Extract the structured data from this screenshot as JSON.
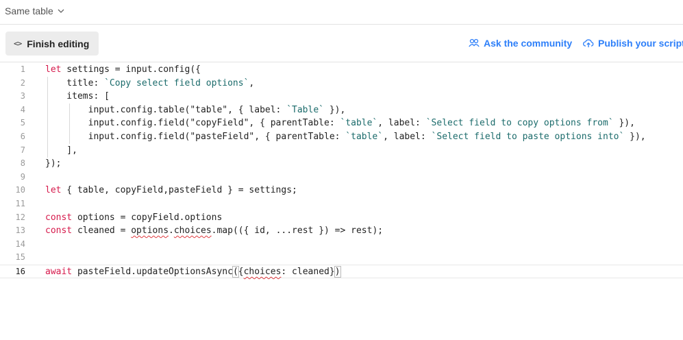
{
  "table_select": {
    "label": "Same table"
  },
  "toolbar": {
    "finish_label": "Finish editing",
    "ask_label": "Ask the community",
    "publish_label": "Publish your script"
  },
  "colors": {
    "accent": "#2d7ff9",
    "keyword": "#d6194b",
    "string": "#1b6b6b"
  },
  "code": {
    "active_line": 16,
    "lines": [
      {
        "n": "1",
        "parts": [
          [
            "kw",
            "let"
          ],
          [
            "",
            "",
            " settings = input.config({"
          ]
        ]
      },
      {
        "n": "2",
        "parts": [
          [
            "",
            "    title: "
          ],
          [
            "str",
            "`Copy select field options`"
          ],
          [
            "",
            ","
          ]
        ]
      },
      {
        "n": "3",
        "parts": [
          [
            "",
            "    items: ["
          ]
        ]
      },
      {
        "n": "4",
        "parts": [
          [
            "",
            "        input.config.table(\"table\", { label: "
          ],
          [
            "str",
            "`Table`"
          ],
          [
            "",
            " }),"
          ]
        ]
      },
      {
        "n": "5",
        "parts": [
          [
            "",
            "        input.config.field(\"copyField\", { parentTable: "
          ],
          [
            "str",
            "`table`"
          ],
          [
            "",
            ", label: "
          ],
          [
            "str",
            "`Select field to copy options from`"
          ],
          [
            "",
            " }),"
          ]
        ]
      },
      {
        "n": "6",
        "parts": [
          [
            "",
            "        input.config.field(\"pasteField\", { parentTable: "
          ],
          [
            "str",
            "`table`"
          ],
          [
            "",
            ", label: "
          ],
          [
            "str",
            "`Select field to paste options into`"
          ],
          [
            "",
            " }),"
          ]
        ]
      },
      {
        "n": "7",
        "parts": [
          [
            "",
            "    ],"
          ]
        ]
      },
      {
        "n": "8",
        "parts": [
          [
            "",
            "});"
          ]
        ]
      },
      {
        "n": "9",
        "parts": []
      },
      {
        "n": "10",
        "parts": [
          [
            "kw",
            "let"
          ],
          [
            "",
            " { table, copyField,pasteField } = settings;"
          ]
        ]
      },
      {
        "n": "11",
        "parts": []
      },
      {
        "n": "12",
        "parts": [
          [
            "kw",
            "const"
          ],
          [
            "",
            " options = copyField.options"
          ]
        ]
      },
      {
        "n": "13",
        "parts": [
          [
            "kw",
            "const"
          ],
          [
            "",
            " cleaned = "
          ],
          [
            "squig",
            "options"
          ],
          [
            "",
            "."
          ],
          [
            "squig",
            "choices"
          ],
          [
            "",
            ".map(({ id, ...rest }) => rest);"
          ]
        ]
      },
      {
        "n": "14",
        "parts": []
      },
      {
        "n": "15",
        "parts": []
      },
      {
        "n": "16",
        "parts": [
          [
            "kw",
            "await"
          ],
          [
            "",
            " pasteField.updateOptionsAsync"
          ],
          [
            "match",
            "("
          ],
          [
            "",
            "{"
          ],
          [
            "squig",
            "choices"
          ],
          [
            "",
            ": cleaned}"
          ],
          [
            "match",
            ")"
          ]
        ]
      }
    ]
  }
}
